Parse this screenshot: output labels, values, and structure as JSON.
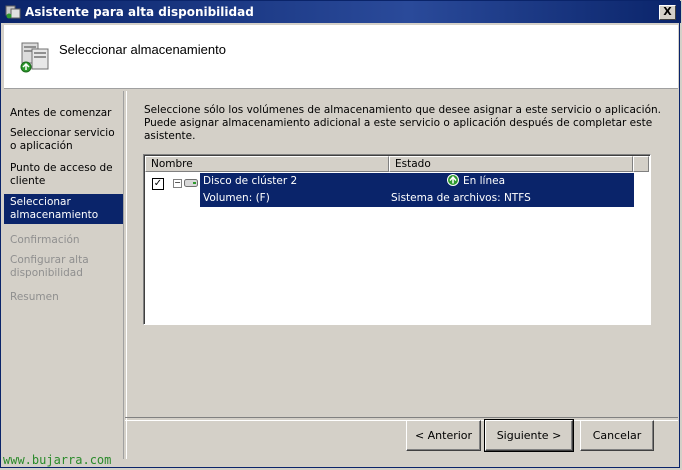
{
  "window": {
    "title": "Asistente para alta disponibilidad",
    "close_label": "X"
  },
  "header": {
    "title": "Seleccionar almacenamiento",
    "icon": "server-storage-icon"
  },
  "sidebar": {
    "items": [
      {
        "label": "Antes de comenzar",
        "state": "normal"
      },
      {
        "label": "Seleccionar servicio o aplicación",
        "state": "normal"
      },
      {
        "label": "Punto de acceso de cliente",
        "state": "normal"
      },
      {
        "label": "Seleccionar almacenamiento",
        "state": "active"
      },
      {
        "label": "Confirmación",
        "state": "disabled"
      },
      {
        "label": "Configurar alta disponibilidad",
        "state": "disabled"
      },
      {
        "label": "Resumen",
        "state": "disabled"
      }
    ]
  },
  "main": {
    "intro_line1": "Seleccione sólo los volúmenes de almacenamiento que desee asignar a este servicio o aplicación.",
    "intro_line2": "Puede asignar almacenamiento adicional a este servicio o aplicación después de completar este asistente.",
    "list": {
      "columns": {
        "name": "Nombre",
        "status": "Estado"
      },
      "rows": [
        {
          "checked": true,
          "name": "Disco de clúster 2",
          "sub_name": "Volumen: (F)",
          "status": "En línea",
          "sub_status": "Sistema de archivos: NTFS",
          "status_icon": "online-arrow-icon"
        }
      ]
    }
  },
  "buttons": {
    "back": "< Anterior",
    "next": "Siguiente >",
    "cancel": "Cancelar"
  },
  "watermark": "www.bujarra.com",
  "colors": {
    "selection": "#0a246a",
    "background": "#d4d0c8",
    "online": "#2e9a2e"
  }
}
